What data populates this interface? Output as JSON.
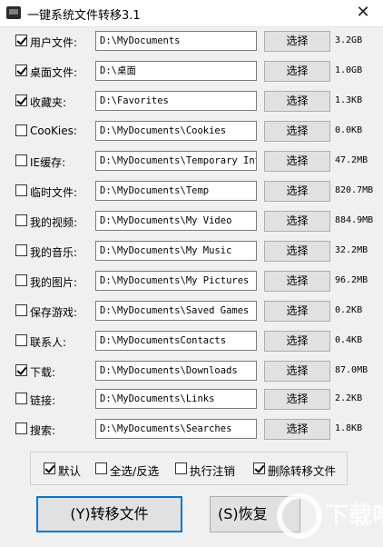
{
  "window": {
    "title": "一键系统文件转移3.1",
    "close_glyph": "✕"
  },
  "rows": [
    {
      "label": "用户文件:",
      "checked": true,
      "path": "D:\\MyDocuments",
      "size": "3.2GB"
    },
    {
      "label": "桌面文件:",
      "checked": true,
      "path": "D:\\桌面",
      "size": "1.0GB"
    },
    {
      "label": "收藏夹:",
      "checked": true,
      "path": "D:\\Favorites",
      "size": "1.3KB"
    },
    {
      "label": "CooKies:",
      "checked": false,
      "path": "D:\\MyDocuments\\Cookies",
      "size": "0.0KB"
    },
    {
      "label": "IE缓存:",
      "checked": false,
      "path": "D:\\MyDocuments\\Temporary Inte",
      "size": "47.2MB"
    },
    {
      "label": "临时文件:",
      "checked": false,
      "path": "D:\\MyDocuments\\Temp",
      "size": "820.7MB"
    },
    {
      "label": "我的视频:",
      "checked": false,
      "path": "D:\\MyDocuments\\My Video",
      "size": "884.9MB"
    },
    {
      "label": "我的音乐:",
      "checked": false,
      "path": "D:\\MyDocuments\\My Music",
      "size": "32.2MB"
    },
    {
      "label": "我的图片:",
      "checked": false,
      "path": "D:\\MyDocuments\\My Pictures",
      "size": "96.2MB"
    },
    {
      "label": "保存游戏:",
      "checked": false,
      "path": "D:\\MyDocuments\\Saved Games",
      "size": "0.2KB"
    },
    {
      "label": "联系人:",
      "checked": false,
      "path": "D:\\MyDocumentsContacts",
      "size": "0.4KB"
    },
    {
      "label": "下载:",
      "checked": true,
      "path": "D:\\MyDocuments\\Downloads",
      "size": "87.0MB"
    },
    {
      "label": "链接:",
      "checked": false,
      "path": "D:\\MyDocuments\\Links",
      "size": "2.2KB"
    },
    {
      "label": "搜索:",
      "checked": false,
      "path": "D:\\MyDocuments\\Searches",
      "size": "1.8KB"
    }
  ],
  "choose_label": "选择",
  "options": [
    {
      "label": "默认",
      "checked": true
    },
    {
      "label": "全选/反选",
      "checked": false
    },
    {
      "label": "执行注销",
      "checked": false
    },
    {
      "label": "删除转移文件",
      "checked": true
    }
  ],
  "buttons": {
    "transfer": "(Y)转移文件",
    "restore": "(S)恢复"
  },
  "watermark": {
    "text": "下载吧"
  },
  "colors": {
    "accent": "#0078d7",
    "button_face": "#e1e1e1",
    "window_bg": "#f0f0f0"
  }
}
